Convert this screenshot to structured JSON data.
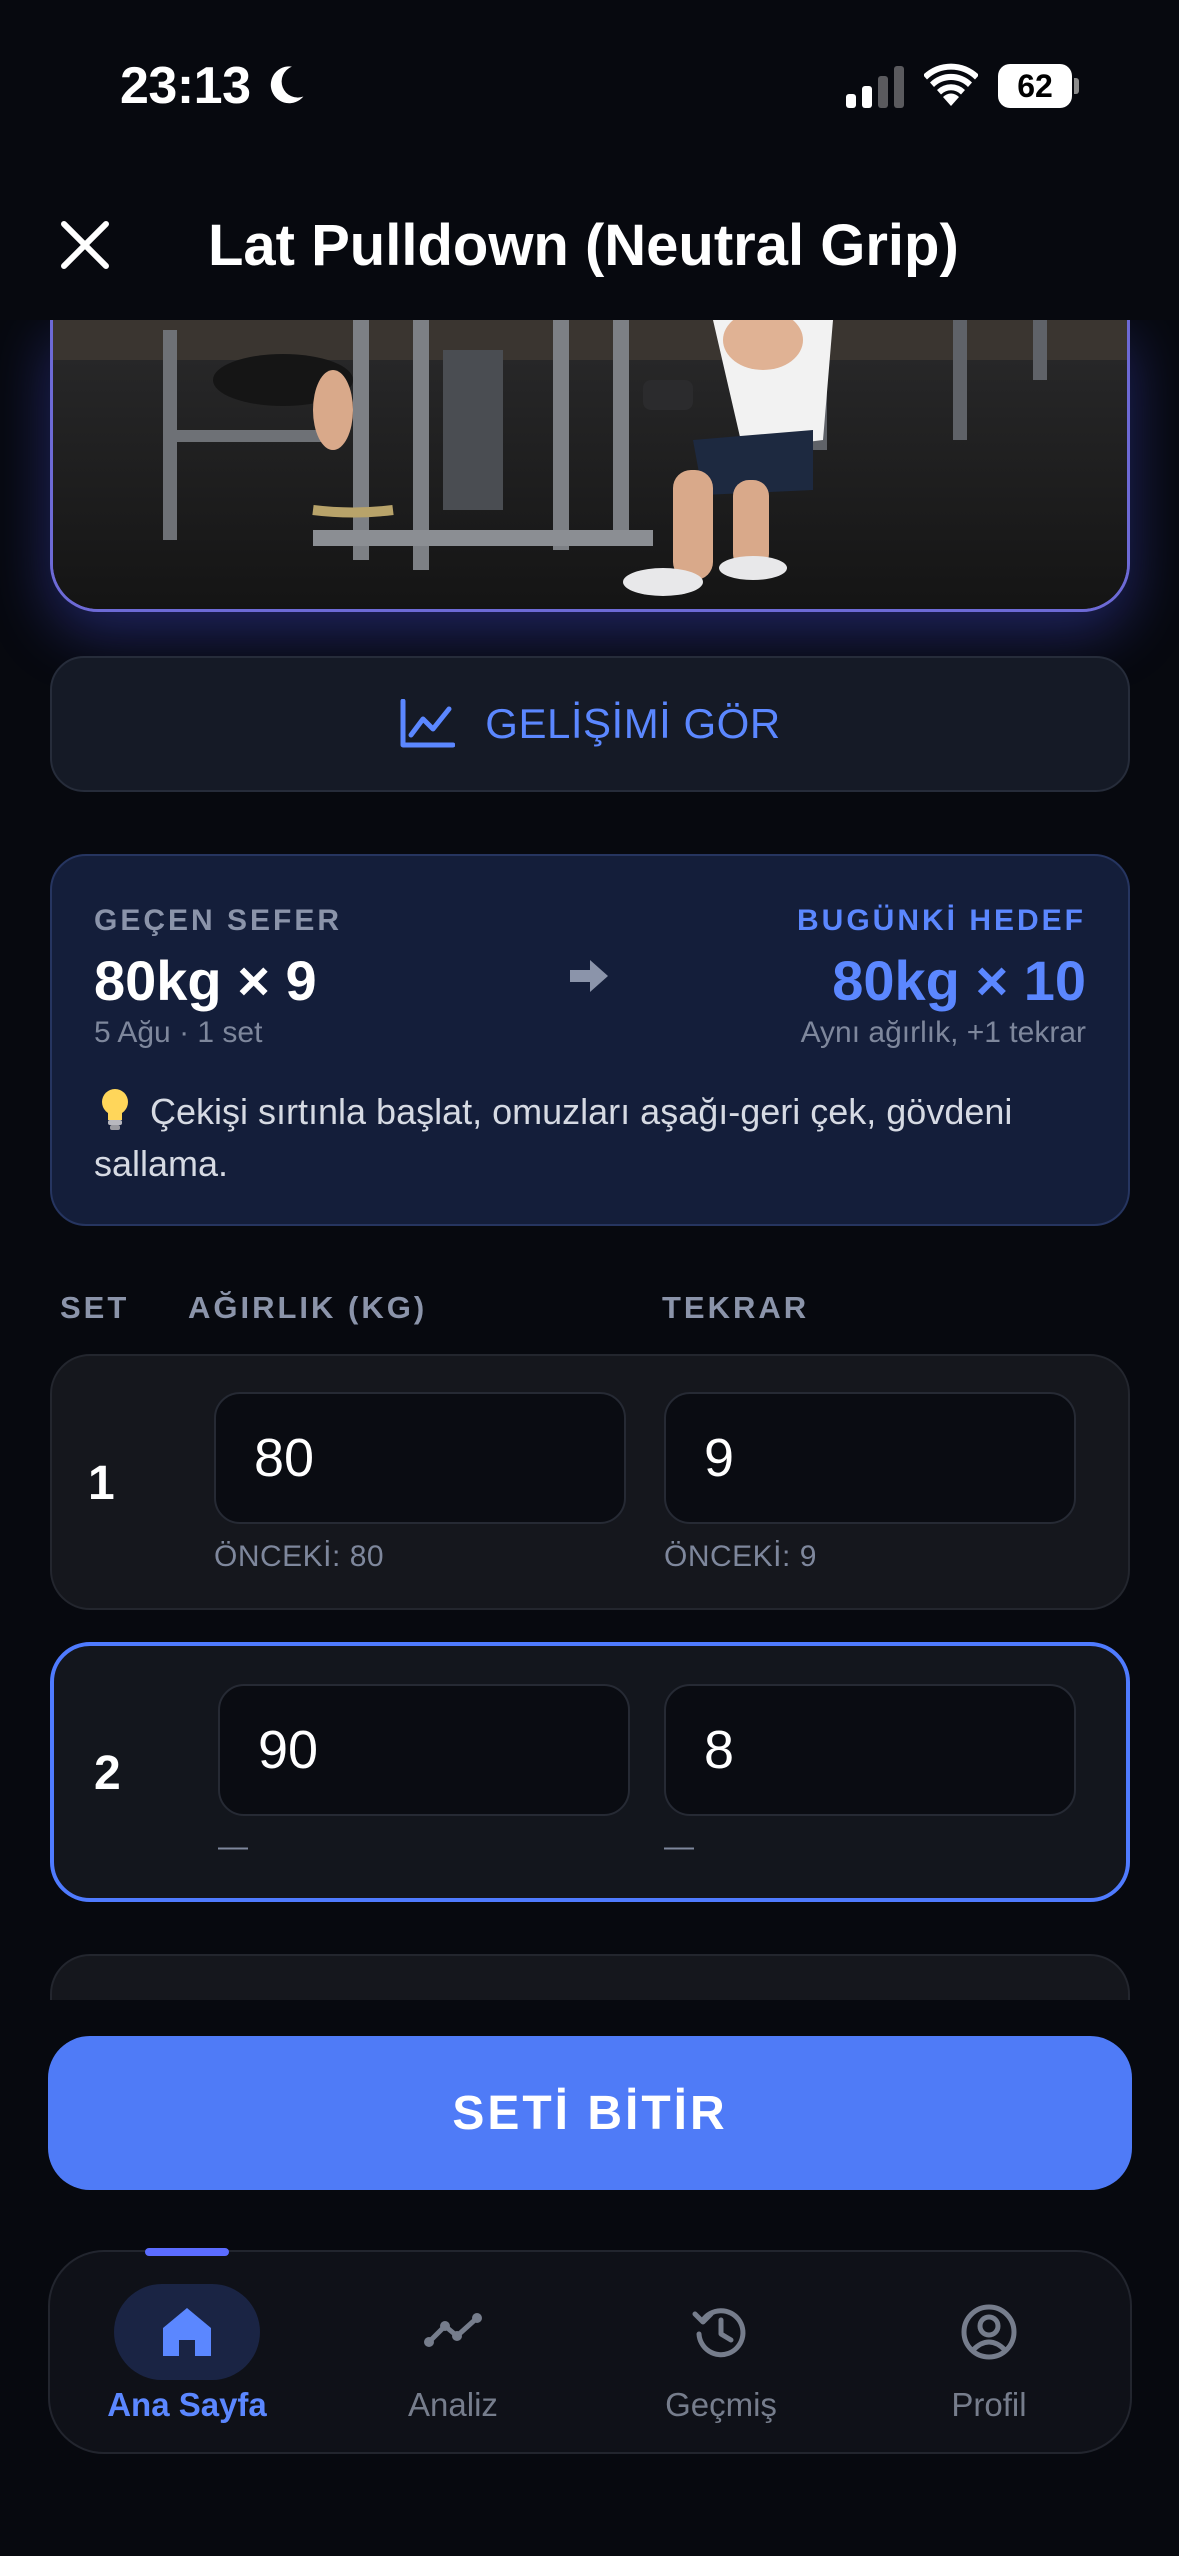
{
  "status_bar": {
    "time": "23:13",
    "battery": "62"
  },
  "header": {
    "title": "Lat Pulldown (Neutral Grip)"
  },
  "progress_button": {
    "label": "GELİŞİMİ GÖR",
    "icon": "trend-chart-icon"
  },
  "comparison": {
    "previous_label": "GEÇEN SEFER",
    "previous_value": "80kg × 9",
    "previous_meta": "5 Ağu · 1 set",
    "target_label": "BUGÜNKİ HEDEF",
    "target_value": "80kg × 10",
    "target_meta": "Aynı ağırlık, +1 tekrar",
    "tip_icon": "lightbulb-icon",
    "tip": "Çekişi sırtınla başlat, omuzları aşağı-geri çek, gövdeni sallama."
  },
  "set_table": {
    "columns": {
      "set": "SET",
      "weight": "AĞIRLIK (KG)",
      "reps": "TEKRAR"
    },
    "sets": [
      {
        "number": "1",
        "weight": "80",
        "reps": "9",
        "prev_weight": "ÖNCEKİ: 80",
        "prev_reps": "ÖNCEKİ: 9"
      },
      {
        "number": "2",
        "weight": "90",
        "reps": "8",
        "prev_weight": "—",
        "prev_reps": "—"
      }
    ]
  },
  "finish_button": {
    "label": "SETİ BİTİR"
  },
  "tabs": [
    {
      "label": "Ana Sayfa",
      "icon": "home-icon",
      "active": true
    },
    {
      "label": "Analiz",
      "icon": "analytics-icon",
      "active": false
    },
    {
      "label": "Geçmiş",
      "icon": "history-icon",
      "active": false
    },
    {
      "label": "Profil",
      "icon": "profile-icon",
      "active": false
    }
  ],
  "colors": {
    "accent": "#5b87ff",
    "button": "#4f7bf7",
    "background": "#07090f"
  }
}
